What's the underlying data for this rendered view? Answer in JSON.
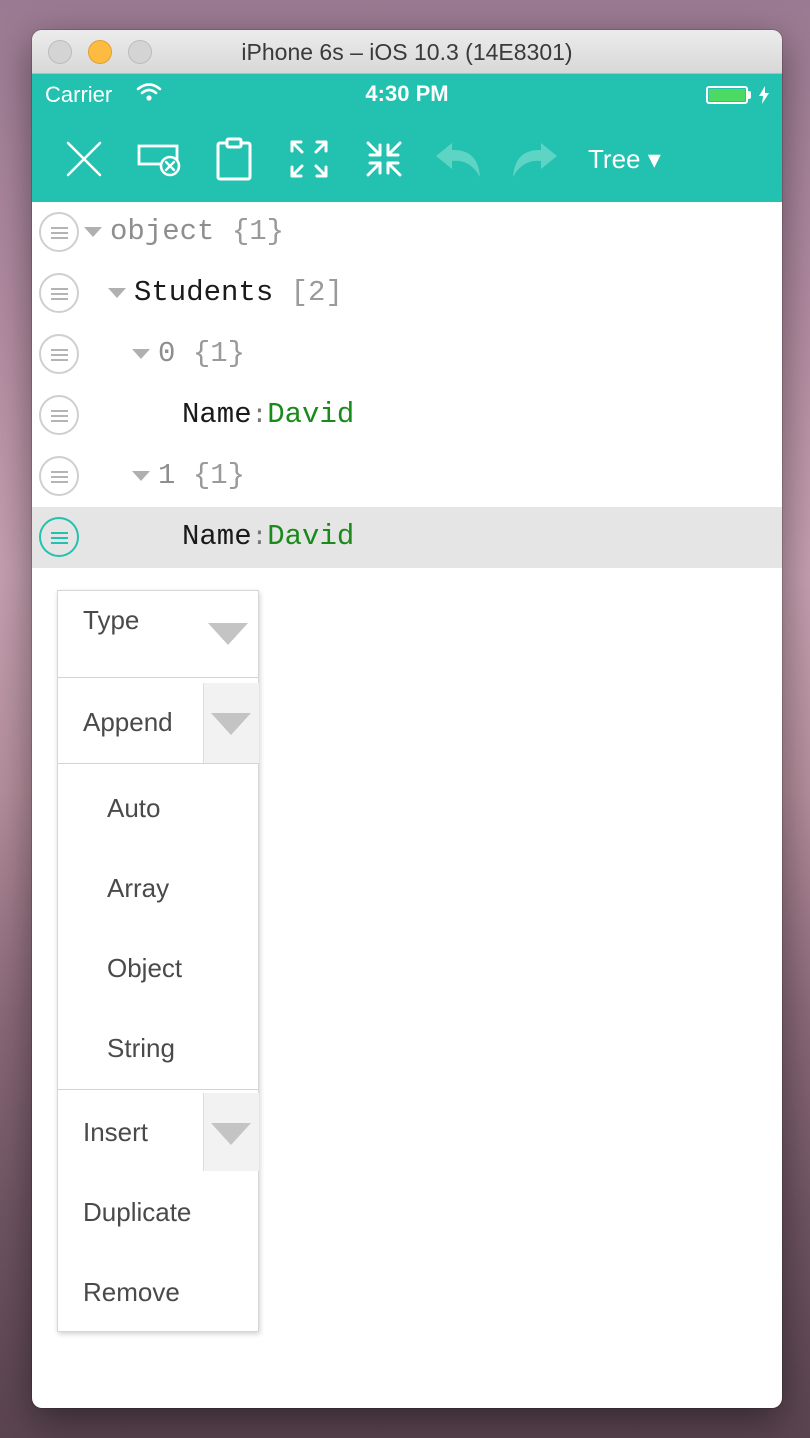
{
  "window": {
    "title": "iPhone 6s – iOS 10.3 (14E8301)"
  },
  "status_bar": {
    "carrier": "Carrier",
    "time": "4:30 PM"
  },
  "toolbar": {
    "buttons": [
      "close-icon",
      "clear-icon",
      "clipboard-icon",
      "expand-all-icon",
      "collapse-all-icon",
      "undo-icon",
      "redo-icon"
    ],
    "mode_label": "Tree ▾"
  },
  "tree": {
    "root": {
      "key": "object",
      "count": "{1}"
    },
    "students": {
      "key": "Students",
      "count": "[2]"
    },
    "item0": {
      "key": "0",
      "count": "{1}",
      "field": {
        "key": "Name",
        "sep": ":",
        "value": "David"
      }
    },
    "item1": {
      "key": "1",
      "count": "{1}",
      "field": {
        "key": "Name",
        "sep": ":",
        "value": "David"
      }
    }
  },
  "context_menu": {
    "type_label": "Type",
    "append_label": "Append",
    "append_options": [
      "Auto",
      "Array",
      "Object",
      "String"
    ],
    "insert_label": "Insert",
    "duplicate_label": "Duplicate",
    "remove_label": "Remove"
  },
  "colors": {
    "accent": "#22c1b0",
    "value_green": "#1a8a1a",
    "battery": "#4cd964"
  }
}
